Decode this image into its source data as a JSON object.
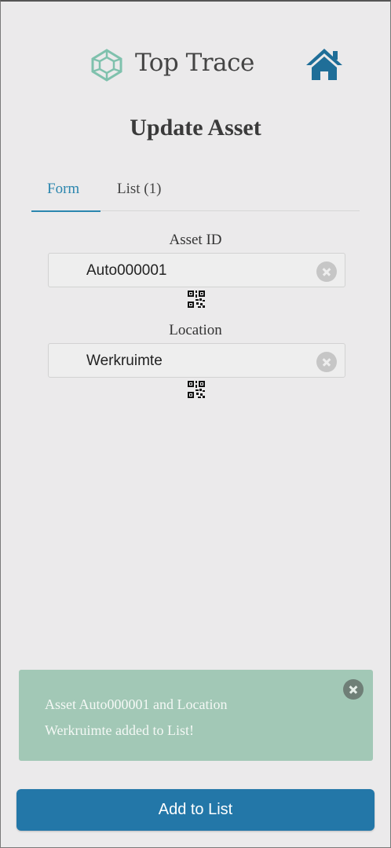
{
  "header": {
    "brand": "Top Trace",
    "logo_icon": "crystal-logo-icon",
    "home_icon": "home-icon",
    "accent_color": "#2377a8"
  },
  "page": {
    "title": "Update Asset"
  },
  "tabs": [
    {
      "label": "Form",
      "active": true
    },
    {
      "label": "List (1)",
      "active": false
    }
  ],
  "form": {
    "asset_id": {
      "label": "Asset ID",
      "value": "Auto000001",
      "clear_icon": "clear-icon",
      "scan_icon": "qr-code-icon"
    },
    "location": {
      "label": "Location",
      "value": "Werkruimte",
      "clear_icon": "clear-icon",
      "scan_icon": "qr-code-icon"
    }
  },
  "toast": {
    "line1": "Asset Auto000001 and Location",
    "line2": "Werkruimte added to List!",
    "close_icon": "close-icon",
    "color": "#a2c8b6"
  },
  "actions": {
    "add_label": "Add to List"
  }
}
